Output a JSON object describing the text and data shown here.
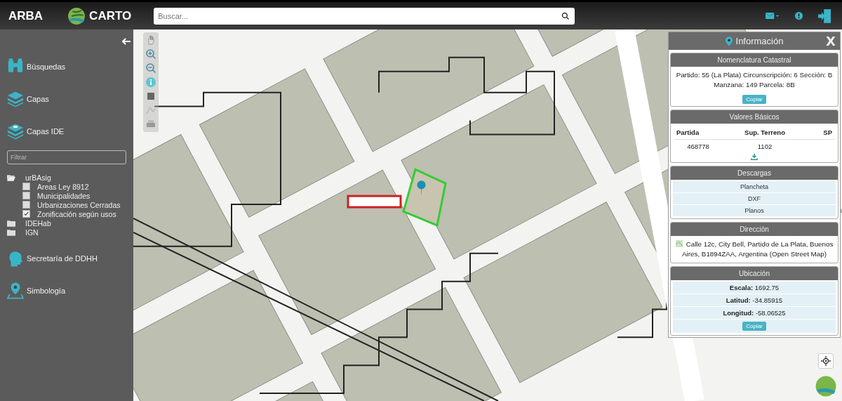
{
  "header": {
    "brand": "ARBA",
    "logo_text": "CARTO",
    "search": {
      "placeholder": "Buscar..."
    }
  },
  "sidebar": {
    "menu_top": [
      {
        "label": "Búsquedas"
      },
      {
        "label": "Capas"
      },
      {
        "label": "Capas IDE"
      }
    ],
    "filter": {
      "placeholder": "Filtrar"
    },
    "layers_tree": [
      {
        "label": "urBAsig",
        "expanded": true,
        "children": [
          {
            "label": "Areas Ley 8912",
            "checked": false
          },
          {
            "label": "Municipalidades",
            "checked": false
          },
          {
            "label": "Urbanizaciones Cerradas",
            "checked": false
          },
          {
            "label": "Zonificación según usos",
            "checked": true
          }
        ]
      },
      {
        "label": "IDEHab",
        "expanded": false
      },
      {
        "label": "IGN",
        "expanded": false
      }
    ],
    "menu_bottom": [
      {
        "label": "Secretaría de DDHH"
      },
      {
        "label": "Simbología"
      }
    ]
  },
  "info_panel": {
    "title": "Información",
    "close": "X",
    "nomenclatura": {
      "title": "Nomenclatura Catastral",
      "text": "Partido: 55 (La Plata) Circunscripción: 6 Sección: B Manzana: 149 Parcela: 8B",
      "button": "Copiar"
    },
    "valores": {
      "title": "Valores Básicos",
      "columns": [
        "Partida",
        "Sup. Terreno",
        "SP"
      ],
      "row": [
        "468778",
        "1102"
      ]
    },
    "descargas": {
      "title": "Descargas",
      "links": [
        "Plancheta",
        "DXF",
        "Planos"
      ]
    },
    "direccion": {
      "title": "Dirección",
      "text": "Calle 12c, City Bell, Partido de La Plata, Buenos Aires, B1894ZAA, Argentina (Open Street Map)"
    },
    "ubicacion": {
      "title": "Ubicación",
      "rows": [
        "**Escala:** 1692.75",
        "**Latitud:** -34.85915",
        "**Longitud:** -58.06525"
      ],
      "button": "Copiar"
    }
  }
}
